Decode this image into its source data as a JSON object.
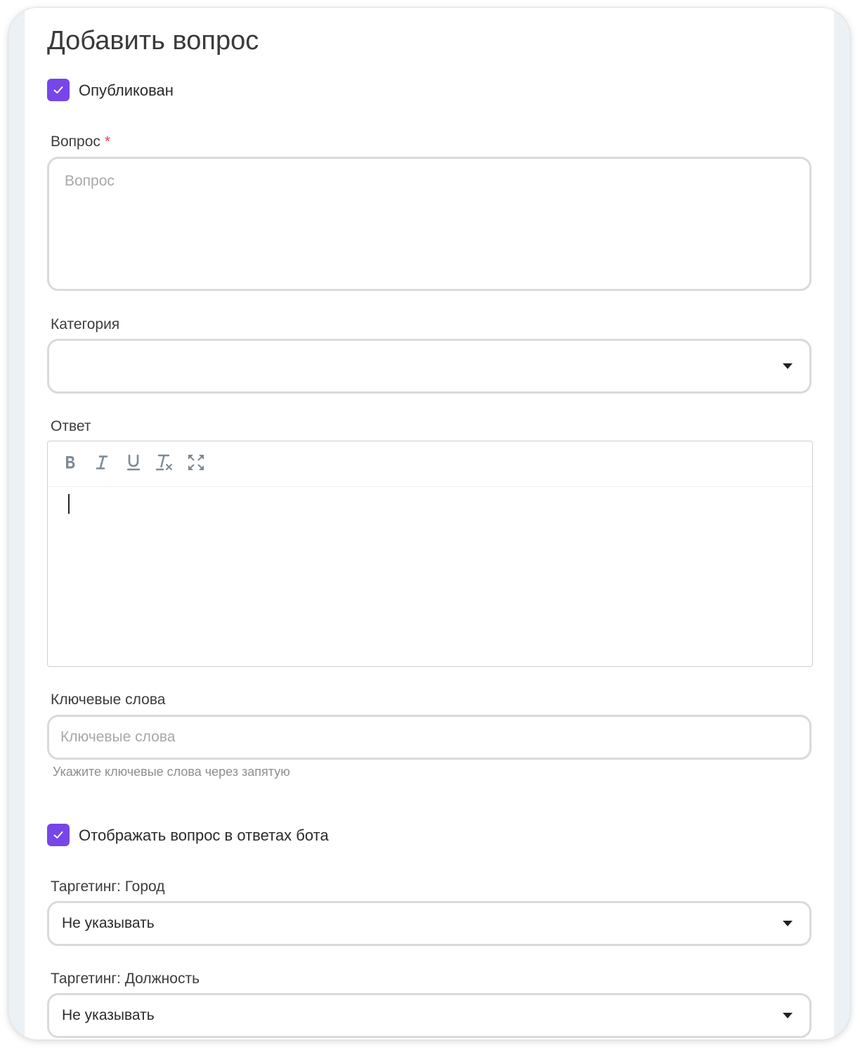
{
  "page": {
    "title": "Добавить вопрос"
  },
  "published": {
    "label": "Опубликован",
    "checked": true
  },
  "question": {
    "label": "Вопрос",
    "required_mark": "*",
    "placeholder": "Вопрос",
    "value": ""
  },
  "category": {
    "label": "Категория",
    "selected": ""
  },
  "answer": {
    "label": "Ответ",
    "toolbar": [
      "bold-icon",
      "italic-icon",
      "underline-icon",
      "clear-format-icon",
      "fullscreen-icon"
    ],
    "value": ""
  },
  "keywords": {
    "label": "Ключевые слова",
    "placeholder": "Ключевые слова",
    "hint": "Укажите ключевые слова через запятую"
  },
  "show_in_bot": {
    "label": "Отображать вопрос в ответах бота",
    "checked": true
  },
  "targeting_city": {
    "label": "Таргетинг: Город",
    "selected": "Не указывать"
  },
  "targeting_position": {
    "label": "Таргетинг: Должность",
    "selected": "Не указывать"
  },
  "colors": {
    "accent": "#7646e8",
    "border": "#dadada",
    "required": "#e04b4b",
    "toolbar_icon": "#7d8994"
  }
}
